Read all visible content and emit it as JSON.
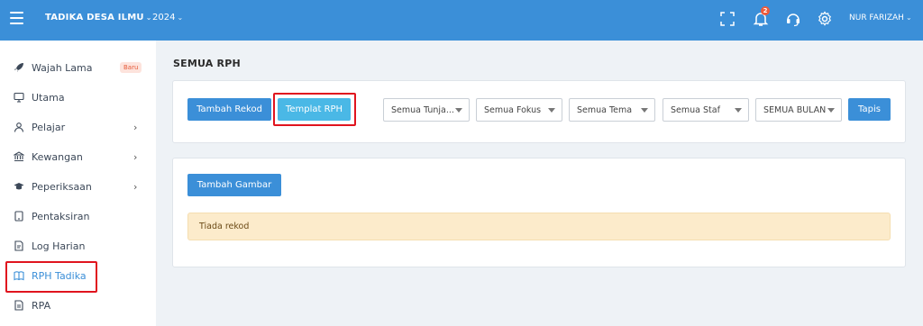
{
  "header": {
    "school_name": "TADIKA DESA ILMU",
    "year": "2024",
    "notification_count": "2",
    "user_name": "NUR FARIZAH",
    "caret": "⌄",
    "icons": [
      "menu-icon",
      "fullscreen-icon",
      "bell-icon",
      "headset-icon",
      "gear-icon"
    ],
    "bar_color": "#3b8fd8"
  },
  "sidebar": {
    "items": [
      {
        "label": "Wajah Lama",
        "icon": "rocket-icon",
        "badge": "Baru"
      },
      {
        "label": "Utama",
        "icon": "monitor-icon"
      },
      {
        "label": "Pelajar",
        "icon": "user-icon",
        "chevron": "›"
      },
      {
        "label": "Kewangan",
        "icon": "bank-icon",
        "chevron": "›"
      },
      {
        "label": "Peperiksaan",
        "icon": "graduation-cap-icon",
        "chevron": "›"
      },
      {
        "label": "Pentaksiran",
        "icon": "tablet-icon"
      },
      {
        "label": "Log Harian",
        "icon": "log-icon"
      },
      {
        "label": "RPH Tadika",
        "icon": "book-icon",
        "active": true
      },
      {
        "label": "RPA",
        "icon": "document-icon"
      }
    ]
  },
  "main": {
    "title": "SEMUA RPH",
    "buttons": {
      "add_record": "Tambah Rekod",
      "template": "Templat RPH",
      "filter": "Tapis",
      "add_image": "Tambah Gambar"
    },
    "filters": [
      "Semua Tunja...",
      "Semua Fokus",
      "Semua Tema",
      "Semua Staf",
      "SEMUA BULAN"
    ],
    "empty_message": "Tiada rekod"
  },
  "colors": {
    "primary": "#3b8fd8",
    "info": "#4ab8e6",
    "highlight": "#e0141e",
    "warning_bg": "#fcebcb"
  }
}
